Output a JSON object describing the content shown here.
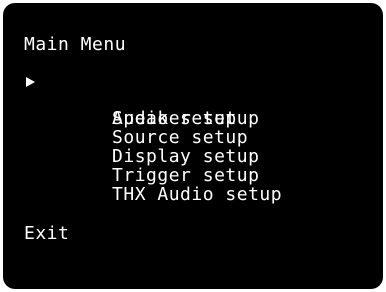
{
  "menu": {
    "title": "Main Menu",
    "selected_index": 0,
    "items": [
      {
        "label": "Audio setup"
      },
      {
        "label": "Speaker setup"
      },
      {
        "label": "Source setup"
      },
      {
        "label": "Display setup"
      },
      {
        "label": "Trigger setup"
      },
      {
        "label": "THX Audio setup"
      }
    ],
    "exit_label": "Exit"
  },
  "colors": {
    "screen_background": "#000000",
    "text": "#ffffff",
    "page_background": "#ffffff"
  },
  "icons": {
    "cursor": "triangle-right-icon"
  }
}
